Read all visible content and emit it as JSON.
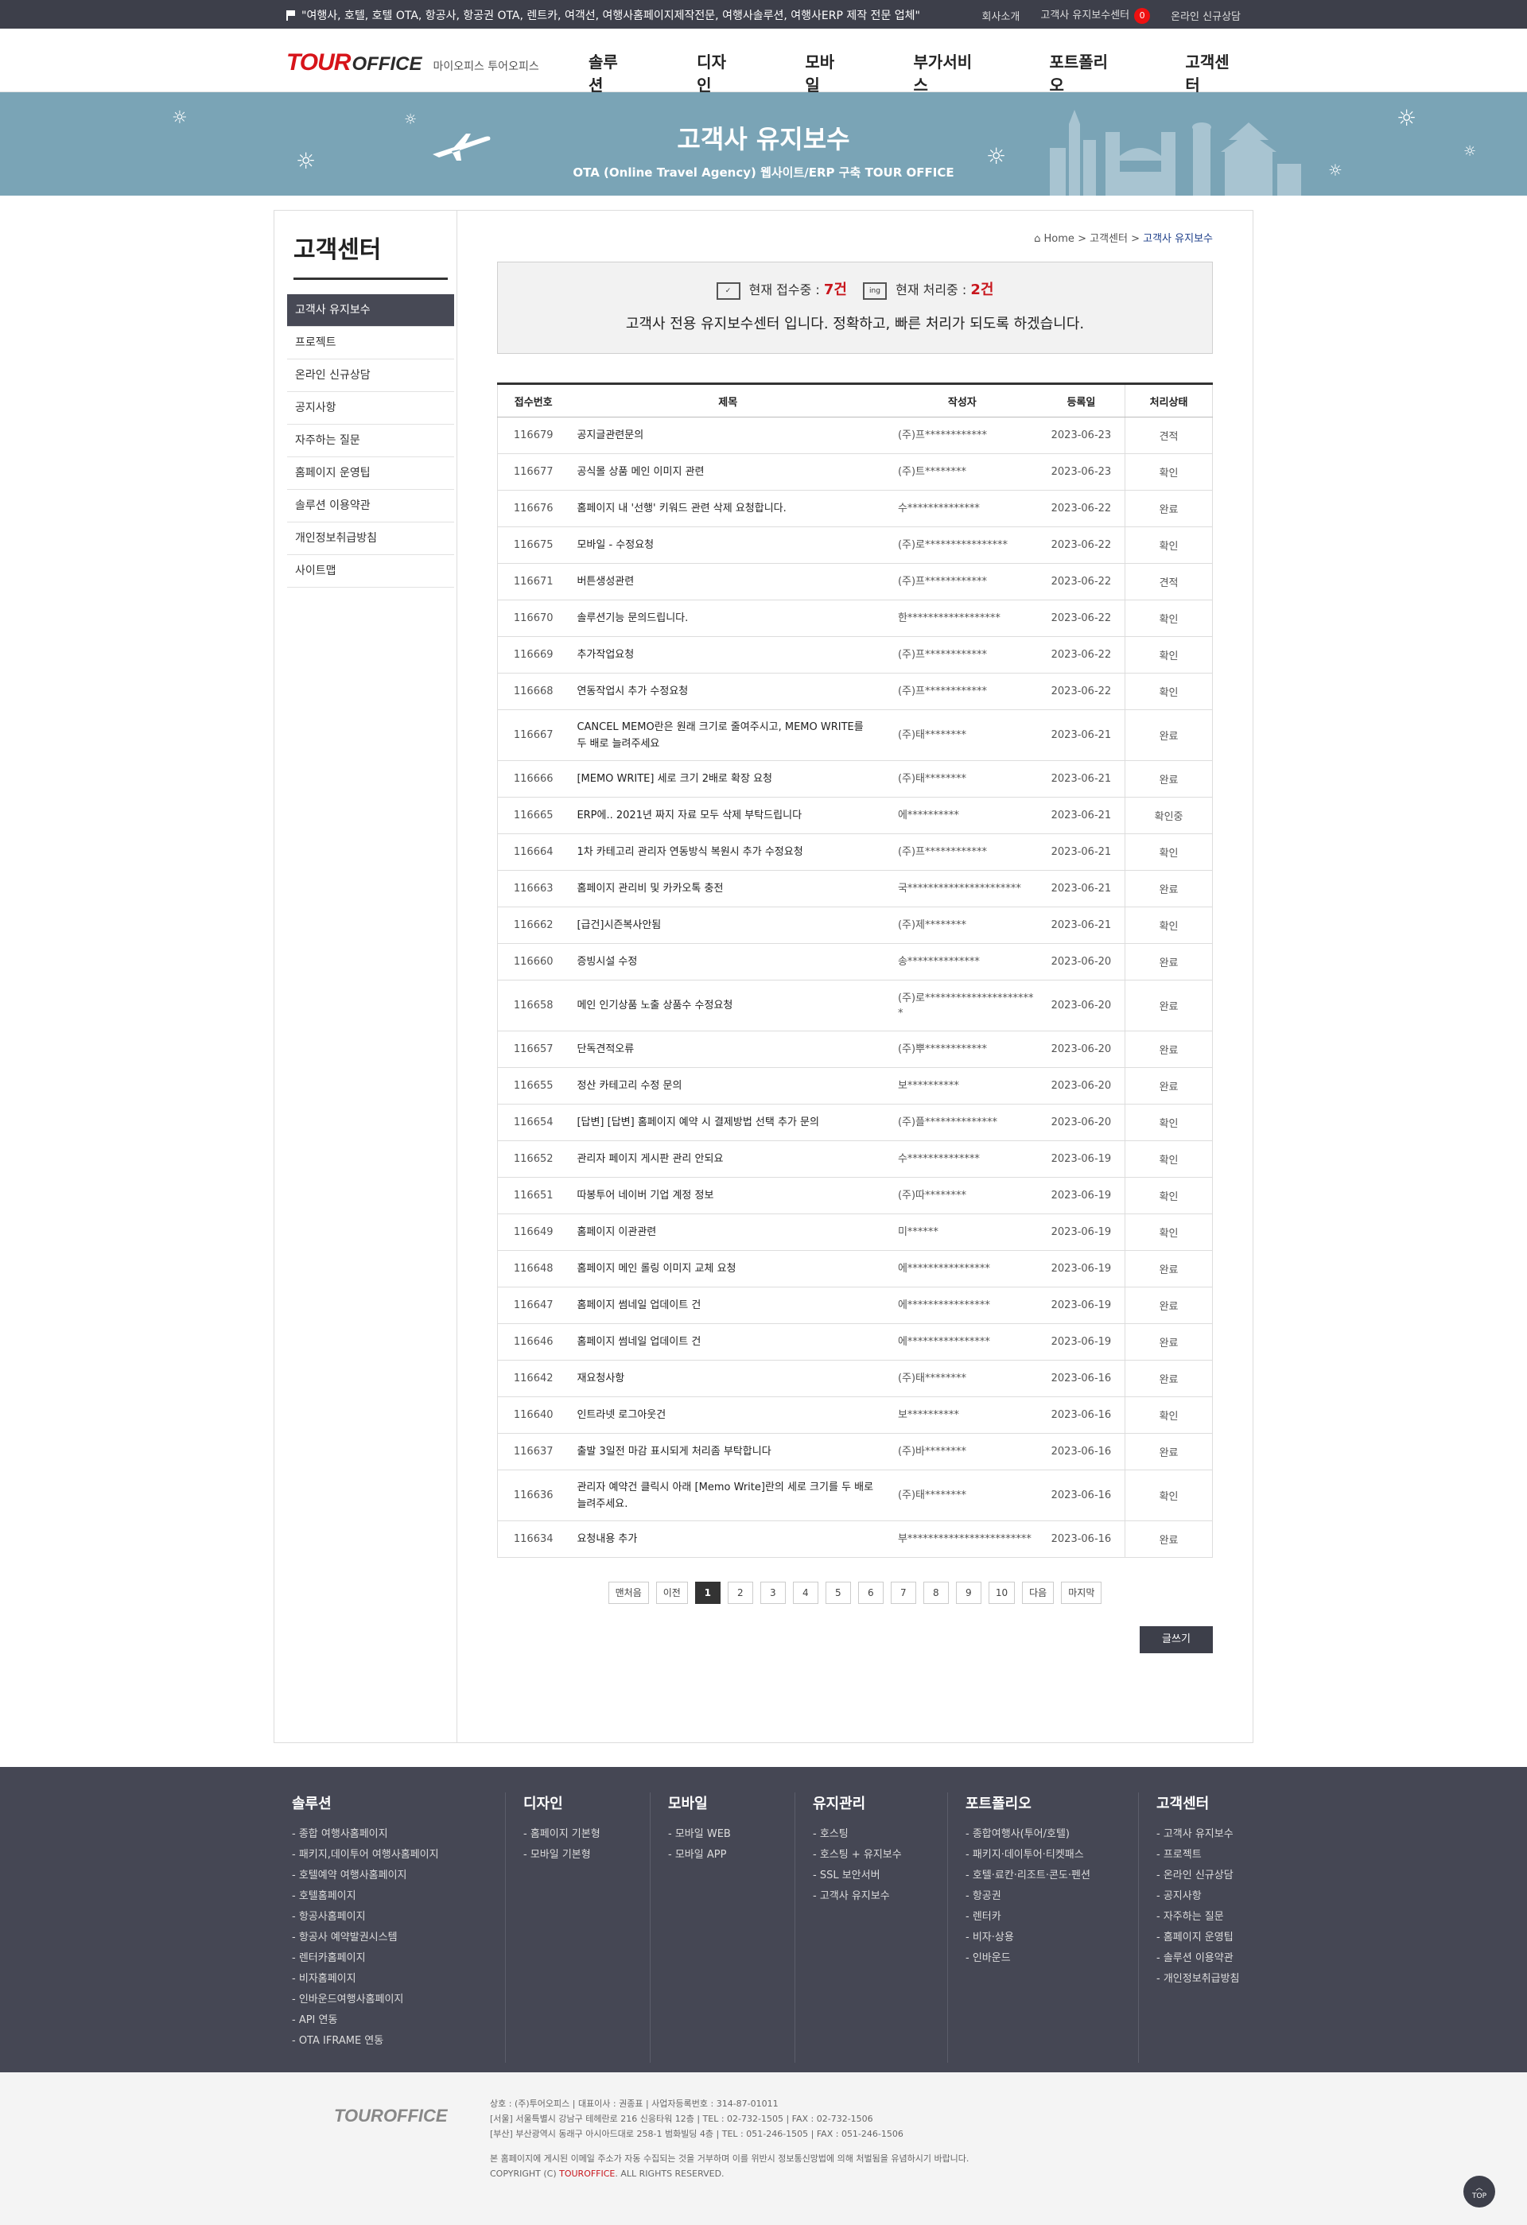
{
  "topbar": {
    "slogan": "\"여행사, 호텔, 호텔 OTA, 항공사, 항공권 OTA, 렌트카, 여객선, 여행사홈페이지제작전문, 여행사솔루션, 여행사ERP 제작 전문 업체\"",
    "links": [
      "회사소개",
      "고객사 유지보수센터",
      "온라인 신규상담"
    ],
    "badge": "0"
  },
  "header": {
    "logo_tour": "TOUR",
    "logo_office": "OFFICE",
    "logo_sub": "마이오피스 투어오피스",
    "gnb": [
      "솔루션",
      "디자인",
      "모바일",
      "부가서비스",
      "포트폴리오",
      "고객센터"
    ]
  },
  "banner": {
    "title": "고객사 유지보수",
    "subtitle": "OTA (Online Travel Agency) 웹사이트/ERP 구축 TOUR OFFICE"
  },
  "lnb": {
    "title": "고객센터",
    "items": [
      "고객사 유지보수",
      "프로젝트",
      "온라인 신규상담",
      "공지사항",
      "자주하는 질문",
      "홈페이지 운영팁",
      "솔루션 이용약관",
      "개인정보취급방침",
      "사이트맵"
    ]
  },
  "breadcrumb": {
    "home": "Home",
    "sep1": ">",
    "mid": "고객센터",
    "sep2": ">",
    "current": "고객사 유지보수"
  },
  "notice": {
    "accept_label": "현재 접수중 :",
    "accept_value": "7건",
    "process_label": "현재 처리중 :",
    "process_value": "2건",
    "process_icon_text": "ing",
    "message": "고객사 전용 유지보수센터 입니다.  정확하고, 빠른 처리가 되도록 하겠습니다."
  },
  "table": {
    "headers": [
      "접수번호",
      "제목",
      "작성자",
      "등록일",
      "처리상태"
    ],
    "rows": [
      {
        "no": "116679",
        "title": "공지글관련문의",
        "writer": "(주)프************",
        "date": "2023-06-23",
        "state": "견적"
      },
      {
        "no": "116677",
        "title": "공식몰 상품 메인 이미지 관련",
        "writer": "(주)트********",
        "date": "2023-06-23",
        "state": "확인"
      },
      {
        "no": "116676",
        "title": "홈페이지 내 '선행' 키워드 관련 삭제 요청합니다.",
        "writer": "수**************",
        "date": "2023-06-22",
        "state": "완료"
      },
      {
        "no": "116675",
        "title": "모바일 - 수정요청",
        "writer": "(주)로****************",
        "date": "2023-06-22",
        "state": "확인"
      },
      {
        "no": "116671",
        "title": "버튼생성관련",
        "writer": "(주)프************",
        "date": "2023-06-22",
        "state": "견적"
      },
      {
        "no": "116670",
        "title": "솔루션기능 문의드립니다.",
        "writer": "한******************",
        "date": "2023-06-22",
        "state": "확인"
      },
      {
        "no": "116669",
        "title": "추가작업요청",
        "writer": "(주)프************",
        "date": "2023-06-22",
        "state": "확인"
      },
      {
        "no": "116668",
        "title": "연동작업시 추가 수정요청",
        "writer": "(주)프************",
        "date": "2023-06-22",
        "state": "확인"
      },
      {
        "no": "116667",
        "title": "CANCEL MEMO란은 원래 크기로 줄여주시고, MEMO WRITE를 두 배로 늘려주세요",
        "writer": "(주)태********",
        "date": "2023-06-21",
        "state": "완료",
        "tall": true
      },
      {
        "no": "116666",
        "title": "[MEMO WRITE] 세로 크기 2배로 확장 요청",
        "writer": "(주)태********",
        "date": "2023-06-21",
        "state": "완료"
      },
      {
        "no": "116665",
        "title": "ERP에.. 2021년 짜지 자료 모두 삭제 부탁드립니다",
        "writer": "에**********",
        "date": "2023-06-21",
        "state": "확인중"
      },
      {
        "no": "116664",
        "title": "1차 카테고리 관리자 연동방식 복원시 추가 수정요청",
        "writer": "(주)프************",
        "date": "2023-06-21",
        "state": "확인"
      },
      {
        "no": "116663",
        "title": "홈페이지 관리비 및 카카오톡 충전",
        "writer": "국**********************",
        "date": "2023-06-21",
        "state": "완료"
      },
      {
        "no": "116662",
        "title": "[급건]시즌복사안됨",
        "writer": "(주)제********",
        "date": "2023-06-21",
        "state": "확인"
      },
      {
        "no": "116660",
        "title": "증빙시설 수정",
        "writer": "송**************",
        "date": "2023-06-20",
        "state": "완료"
      },
      {
        "no": "116658",
        "title": "메인 인기상품 노출 상품수 수정요청",
        "writer": "(주)로**********************",
        "date": "2023-06-20",
        "state": "완료",
        "tall": true
      },
      {
        "no": "116657",
        "title": "단독견적오류",
        "writer": "(주)뿌************",
        "date": "2023-06-20",
        "state": "완료"
      },
      {
        "no": "116655",
        "title": "정산 카테고리 수정 문의",
        "writer": "보**********",
        "date": "2023-06-20",
        "state": "완료"
      },
      {
        "no": "116654",
        "title": "[답변] [답변] 홈페이지 예약 시 결제방법 선택 추가 문의",
        "writer": "(주)플**************",
        "date": "2023-06-20",
        "state": "확인"
      },
      {
        "no": "116652",
        "title": "관리자 페이지 게시판 관리 안되요",
        "writer": "수**************",
        "date": "2023-06-19",
        "state": "확인"
      },
      {
        "no": "116651",
        "title": "따봉투어 네이버 기업 계정 정보",
        "writer": "(주)따********",
        "date": "2023-06-19",
        "state": "확인"
      },
      {
        "no": "116649",
        "title": "홈페이지 이관관련",
        "writer": "미******",
        "date": "2023-06-19",
        "state": "확인"
      },
      {
        "no": "116648",
        "title": "홈페이지 메인 롤링 이미지 교체 요청",
        "writer": "에****************",
        "date": "2023-06-19",
        "state": "완료"
      },
      {
        "no": "116647",
        "title": "홈페이지 썸네일 업데이트 건",
        "writer": "에****************",
        "date": "2023-06-19",
        "state": "완료"
      },
      {
        "no": "116646",
        "title": "홈페이지 썸네일 업데이트 건",
        "writer": "에****************",
        "date": "2023-06-19",
        "state": "완료"
      },
      {
        "no": "116642",
        "title": "재요청사항",
        "writer": "(주)태********",
        "date": "2023-06-16",
        "state": "완료"
      },
      {
        "no": "116640",
        "title": "인트라넷 로그아웃건",
        "writer": "보**********",
        "date": "2023-06-16",
        "state": "확인"
      },
      {
        "no": "116637",
        "title": "출발 3일전 마감 표시되게 처리좀 부탁합니다",
        "writer": "(주)바********",
        "date": "2023-06-16",
        "state": "완료"
      },
      {
        "no": "116636",
        "title": "관리자 예약건 클릭시 아래 [Memo Write]란의 세로 크기를 두 배로 늘려주세요.",
        "writer": "(주)태********",
        "date": "2023-06-16",
        "state": "확인",
        "tall": true
      },
      {
        "no": "116634",
        "title": "요청내용 추가",
        "writer": "부************************",
        "date": "2023-06-16",
        "state": "완료"
      }
    ]
  },
  "paging": [
    "맨처음",
    "이전",
    "1",
    "2",
    "3",
    "4",
    "5",
    "6",
    "7",
    "8",
    "9",
    "10",
    "다음",
    "마지막"
  ],
  "paging_current": "1",
  "write_button": "글쓰기",
  "footer_nav": [
    {
      "title": "솔루션",
      "items": [
        "종합 여행사홈페이지",
        "패키지,데이투어 여행사홈페이지",
        "호텔예약 여행사홈페이지",
        "호텔홈페이지",
        "항공사홈페이지",
        "항공사 예약발권시스템",
        "렌터카홈페이지",
        "비자홈페이지",
        "인바운드여행사홈페이지",
        "API 연동",
        "OTA IFRAME 연동"
      ]
    },
    {
      "title": "디자인",
      "items": [
        "홈페이지 기본형",
        "모바일 기본형"
      ]
    },
    {
      "title": "모바일",
      "items": [
        "모바일 WEB",
        "모바일 APP"
      ]
    },
    {
      "title": "유지관리",
      "items": [
        "호스팅",
        "호스팅 + 유지보수",
        "SSL 보안서버",
        "고객사 유지보수"
      ]
    },
    {
      "title": "포트폴리오",
      "items": [
        "종합여행사(투어/호텔)",
        "패키지·데이투어·티켓패스",
        "호텔·료칸·리조트·콘도·펜션",
        "항공권",
        "렌터카",
        "비자·상용",
        "인바운드"
      ]
    },
    {
      "title": "고객센터",
      "items": [
        "고객사 유지보수",
        "프로젝트",
        "온라인 신규상담",
        "공지사항",
        "자주하는 질문",
        "홈페이지 운영팁",
        "솔루션 이용약관",
        "개인정보취급방침"
      ]
    }
  ],
  "footer_info": {
    "logo_tour": "TOUR",
    "logo_office": "OFFICE",
    "line1": "상호 : (주)투어오피스  |  대표이사 : 권종표  |  사업자등록번호 : 314-87-01011",
    "line2": "[서울] 서울특별시 강남구 테헤란로 216 신응타워 12층  |  TEL : 02-732-1505  |  FAX : 02-732-1506",
    "line3": "[부산] 부산광역시 동래구 아시아드대로 258-1 범화빌딩 4층  |  TEL : 051-246-1505  |  FAX : 051-246-1506",
    "line4": "본 홈페이지에 게시된 이메일 주소가 자동 수집되는 것을 거부하며 이를 위반시 정보통신망법에 의해 처벌됨을 유념하시기 바랍니다.",
    "copy_prefix": "COPYRIGHT (C)",
    "copy_brand": "TOUROFFICE",
    "copy_suffix": ". ALL RIGHTS RESERVED.",
    "top": "TOP"
  }
}
